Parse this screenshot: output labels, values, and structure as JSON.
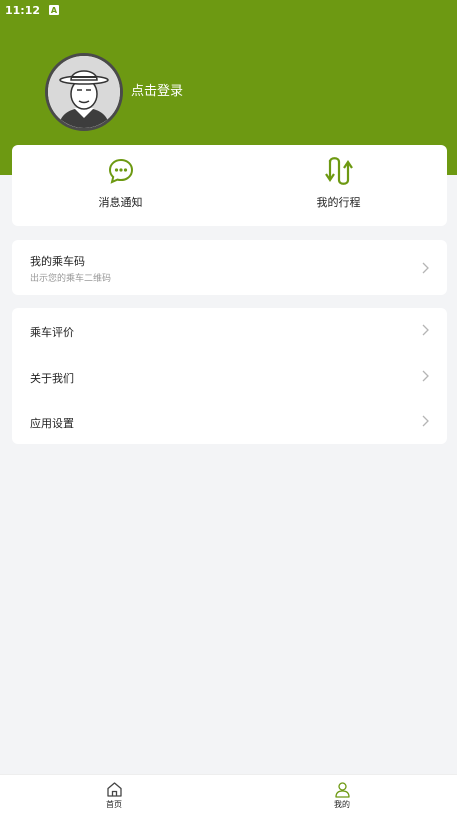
{
  "status_bar": {
    "time": "11:12",
    "indicator": "A"
  },
  "profile": {
    "login_label": "点击登录",
    "avatar_icon": "person-with-hat-avatar"
  },
  "quick_actions": [
    {
      "label": "消息通知",
      "icon": "chat-bubble-icon"
    },
    {
      "label": "我的行程",
      "icon": "route-arrows-icon"
    }
  ],
  "ride_code": {
    "title": "我的乘车码",
    "subtitle": "出示您的乘车二维码"
  },
  "menu": [
    {
      "label": "乘车评价"
    },
    {
      "label": "关于我们"
    },
    {
      "label": "应用设置"
    }
  ],
  "tabbar": [
    {
      "label": "首页",
      "icon": "home-icon"
    },
    {
      "label": "我的",
      "icon": "person-icon",
      "active": true
    }
  ],
  "colors": {
    "brand": "#6d9912",
    "background": "#f3f4f6",
    "card": "#ffffff",
    "muted": "#999999"
  }
}
